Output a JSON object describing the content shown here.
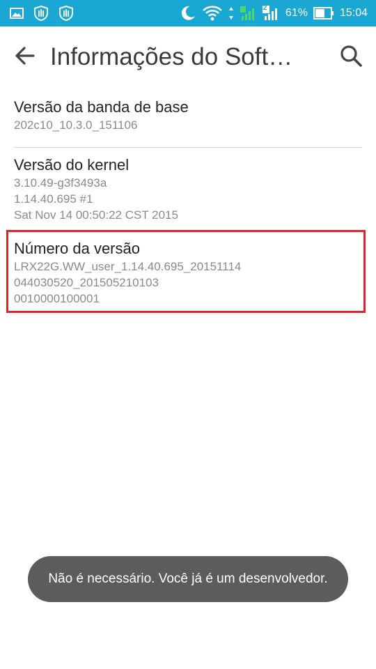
{
  "status_bar": {
    "left_icons": [
      "image-icon",
      "hand-shield-icon",
      "hand-shield-icon"
    ],
    "right_icons": [
      "moon-icon",
      "wifi-icon",
      "signal-sim1-icon",
      "signal-sim2-icon",
      "battery-icon"
    ],
    "sim2_badge": "2",
    "battery_percent": "61%",
    "time": "15:04",
    "color": "#1aa7d3"
  },
  "app_bar": {
    "title": "Informações do Soft…",
    "back_icon": "arrow-back-icon",
    "search_icon": "search-icon"
  },
  "items": [
    {
      "title": "Versão da banda de base",
      "summary": [
        "202c10_10.3.0_151106"
      ]
    },
    {
      "title": "Versão do kernel",
      "summary": [
        "3.10.49-g3f3493a",
        "1.14.40.695 #1",
        "Sat Nov 14 00:50:22 CST 2015"
      ]
    },
    {
      "title": "Número da versão",
      "summary": [
        "LRX22G.WW_user_1.14.40.695_20151114",
        "044030520_201505210103",
        "0010000100001"
      ]
    }
  ],
  "highlight_color": "#d9262e",
  "toast": {
    "message": "Não é necessário. Você já é um desenvolvedor."
  }
}
